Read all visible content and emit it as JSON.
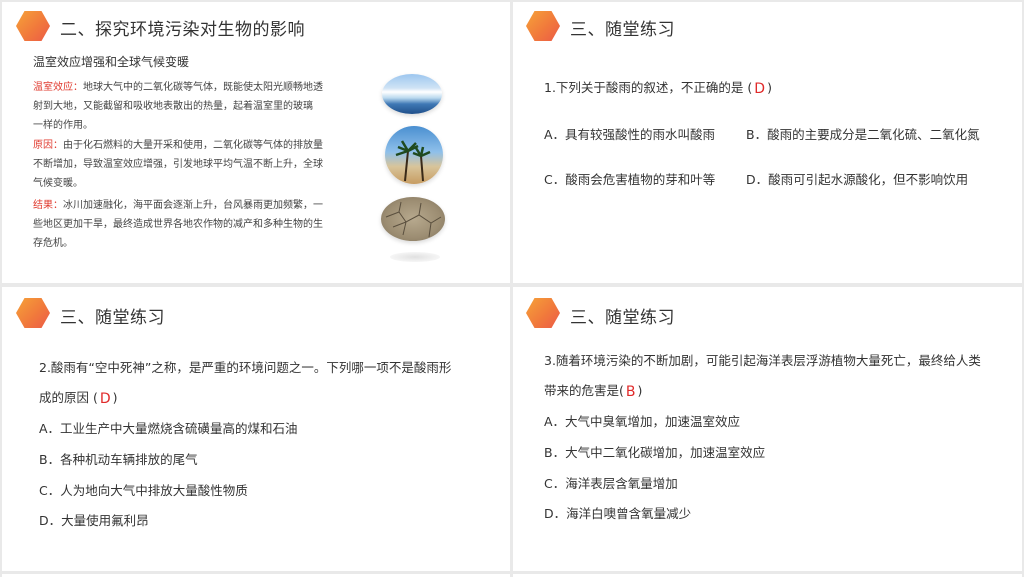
{
  "panel1": {
    "title": "二、探究环境污染对生物的影响",
    "subtitle": "温室效应增强和全球气候变暖",
    "greenhouse_label": "温室效应：",
    "greenhouse_text_1": "地球大气中的二氧化碳等气体，既能使太阳光顺畅地透",
    "greenhouse_text_2": "射到大地，又能截留和吸收地表散出的热量，起着温室里的玻璃",
    "greenhouse_text_3": "一样的作用。",
    "cause_label": "原因：",
    "cause_text_1": "由于化石燃料的大量开采和使用，二氧化碳等气体的排放量",
    "cause_text_2": "不断增加，导致温室效应增强，引发地球平均气温不断上升，全球",
    "cause_text_3": "气候变暖。",
    "result_label": "结果：",
    "result_text_1": "冰川加速融化，海平面会逐渐上升，台风暴雨更加频繁，一",
    "result_text_2": "些地区更加干旱，最终造成世界各地农作物的减产和多种生物的生",
    "result_text_3": "存危机。"
  },
  "panel2": {
    "title": "三、随堂练习",
    "question_prefix": "1.下列关于酸雨的叙述，不正确的是 (",
    "answer": "D",
    "question_suffix": ")",
    "option_a": "A．具有较强酸性的雨水叫酸雨",
    "option_b": "B．酸雨的主要成分是二氧化硫、二氧化氮",
    "option_c": "C．酸雨会危害植物的芽和叶等",
    "option_d": "D．酸雨可引起水源酸化，但不影响饮用"
  },
  "panel3": {
    "title": "三、随堂练习",
    "question_line1": "2.酸雨有“空中死神”之称，是严重的环境问题之一。下列哪一项不是酸雨形",
    "question_line2_prefix": "成的原因 (",
    "answer": "D",
    "question_suffix": ")",
    "option_a": "A．工业生产中大量燃烧含硫磺量高的煤和石油",
    "option_b": "B．各种机动车辆排放的尾气",
    "option_c": "C．人为地向大气中排放大量酸性物质",
    "option_d": "D．大量使用氟利昂"
  },
  "panel4": {
    "title": "三、随堂练习",
    "question_line1": "3.随着环境污染的不断加剧，可能引起海洋表层浮游植物大量死亡，最终给人类",
    "question_line2_prefix": "带来的危害是(",
    "answer": "B",
    "question_suffix": ")",
    "option_a": "A．大气中臭氧增加，加速温室效应",
    "option_b": "B．大气中二氧化碳增加，加速温室效应",
    "option_c": "C．海洋表层含氧量增加",
    "option_d": "D．海洋白噢曾含氧量减少"
  },
  "colors": {
    "hex_start": "#f6a23a",
    "hex_end": "#ec5a47",
    "label_red": "#e03b2f",
    "answer_red": "#e02a2a"
  },
  "icons": [
    "hexagon-icon"
  ]
}
